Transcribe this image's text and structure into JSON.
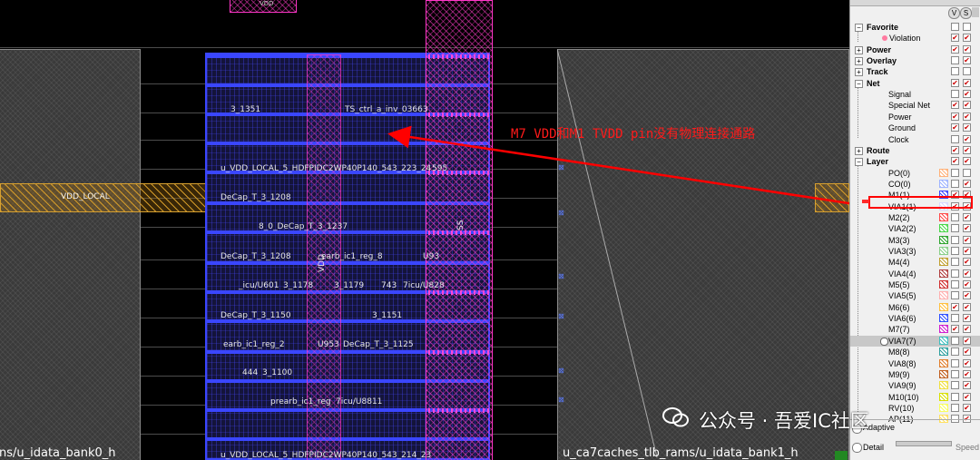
{
  "canvas": {
    "labels": {
      "vdd_local_left": "VDD_LOCAL",
      "bank0": "ns/u_idata_bank0_h",
      "bank1": "u_ca7caches_tlb_rams/u_idata_bank1_h",
      "vdd_vertical": "VDD",
      "vss": "SS",
      "tiny_top": "VDD"
    },
    "cells": [
      "3_1351",
      "TS_ctrl_a_inv_03663",
      "u_VDD_LOCAL_5_HDFPIDC2WP40P140_543_223_24",
      "595",
      "DeCap_T_3_1208",
      "8_0_DeCap_T_3_1237",
      "DeCap_T_3_1208",
      "earb_ic1_reg_8",
      "U93",
      "_icu/U601",
      "3_1178",
      "3_1179",
      "743",
      "7icu/U828",
      "DeCap_T_3_1150",
      "3_1151",
      "earb_ic1_reg_2",
      "U953",
      "DeCap_T_3_1125",
      "444",
      "3_1100",
      "prearb_ic1_reg",
      "7icu/U8811",
      "u_VDD_LOCAL_5_HDFPIDC2WP40P140_543_214_23"
    ],
    "annotation": "M7 VDD和M1 TVDD pin没有物理连接通路",
    "watermark": "公众号 · 吾爱IC社区"
  },
  "panel": {
    "top_icons": [
      "V",
      "S"
    ],
    "tree": [
      {
        "type": "cat",
        "label": "Favorite",
        "expander": "−",
        "c1": false,
        "c2": false
      },
      {
        "type": "sub",
        "label": "Violation",
        "marker": "pink-dot",
        "c1": true,
        "c2": true
      },
      {
        "type": "cat",
        "label": "Power",
        "expander": "+",
        "c1": true,
        "c2": true
      },
      {
        "type": "cat",
        "label": "Overlay",
        "expander": "+",
        "c1": false,
        "c2": true
      },
      {
        "type": "cat",
        "label": "Track",
        "expander": "+",
        "c1": false,
        "c2": false
      },
      {
        "type": "cat",
        "label": "Net",
        "expander": "−",
        "c1": true,
        "c2": true
      },
      {
        "type": "sub",
        "label": "Signal",
        "c1": false,
        "c2": true
      },
      {
        "type": "sub",
        "label": "Special Net",
        "c1": true,
        "c2": true
      },
      {
        "type": "sub",
        "label": "Power",
        "c1": true,
        "c2": true
      },
      {
        "type": "sub",
        "label": "Ground",
        "c1": true,
        "c2": true
      },
      {
        "type": "sub",
        "label": "Clock",
        "c1": false,
        "c2": true
      },
      {
        "type": "cat",
        "label": "Route",
        "expander": "+",
        "c1": true,
        "c2": true
      },
      {
        "type": "cat",
        "label": "Layer",
        "expander": "−",
        "c1": true,
        "c2": true
      },
      {
        "type": "layer",
        "label": "PO(0)",
        "color": "#ffb27a",
        "c1": false,
        "c2": false
      },
      {
        "type": "layer",
        "label": "CO(0)",
        "color": "#9fb4ff",
        "c1": false,
        "c2": true
      },
      {
        "type": "layer",
        "label": "M1(1)",
        "color": "#3a46ff",
        "c1": true,
        "c2": true
      },
      {
        "type": "layer",
        "label": "VIA1(1)",
        "color": "#d8d8ff",
        "c1": true,
        "c2": true
      },
      {
        "type": "layer",
        "label": "M2(2)",
        "color": "#ff4a4a",
        "c1": false,
        "c2": true
      },
      {
        "type": "layer",
        "label": "VIA2(2)",
        "color": "#4ad84a",
        "c1": false,
        "c2": true
      },
      {
        "type": "layer",
        "label": "M3(3)",
        "color": "#2fa52f",
        "c1": false,
        "c2": true
      },
      {
        "type": "layer",
        "label": "VIA3(3)",
        "color": "#8ad08a",
        "c1": false,
        "c2": true
      },
      {
        "type": "layer",
        "label": "M4(4)",
        "color": "#c0a030",
        "c1": false,
        "c2": true
      },
      {
        "type": "layer",
        "label": "VIA4(4)",
        "color": "#b04040",
        "c1": false,
        "c2": true
      },
      {
        "type": "layer",
        "label": "M5(5)",
        "color": "#d03030",
        "c1": false,
        "c2": true
      },
      {
        "type": "layer",
        "label": "VIA5(5)",
        "color": "#ffb0b0",
        "c1": false,
        "c2": true
      },
      {
        "type": "layer",
        "label": "M6(6)",
        "color": "#ffc040",
        "c1": true,
        "c2": true
      },
      {
        "type": "layer",
        "label": "VIA6(6)",
        "color": "#3050ff",
        "c1": false,
        "c2": true
      },
      {
        "type": "layer",
        "label": "M7(7)",
        "color": "#d020d0",
        "c1": true,
        "c2": true
      },
      {
        "type": "layer",
        "label": "VIA7(7)",
        "color": "#40c0c0",
        "c1": false,
        "c2": true,
        "selected": true
      },
      {
        "type": "layer",
        "label": "M8(8)",
        "color": "#30a0a0",
        "c1": false,
        "c2": true
      },
      {
        "type": "layer",
        "label": "VIA8(8)",
        "color": "#e08030",
        "c1": false,
        "c2": true
      },
      {
        "type": "layer",
        "label": "M9(9)",
        "color": "#c06020",
        "c1": false,
        "c2": true
      },
      {
        "type": "layer",
        "label": "VIA9(9)",
        "color": "#f0e040",
        "c1": false,
        "c2": true
      },
      {
        "type": "layer",
        "label": "M10(10)",
        "color": "#d8e000",
        "c1": false,
        "c2": true
      },
      {
        "type": "layer",
        "label": "RV(10)",
        "color": "#f8ff60",
        "c1": false,
        "c2": true
      },
      {
        "type": "layer",
        "label": "AP(11)",
        "color": "#ffe060",
        "c1": false,
        "c2": true
      }
    ],
    "adaptive_label": "Adaptive",
    "detail_label": "Detail",
    "speed_label": "Speed"
  },
  "colors": {
    "background": "#000000",
    "metal1": "#3a46ff",
    "metal7": "#ff36c8",
    "vdd_local": "#d7a030",
    "annotation": "#ff1a1a"
  }
}
